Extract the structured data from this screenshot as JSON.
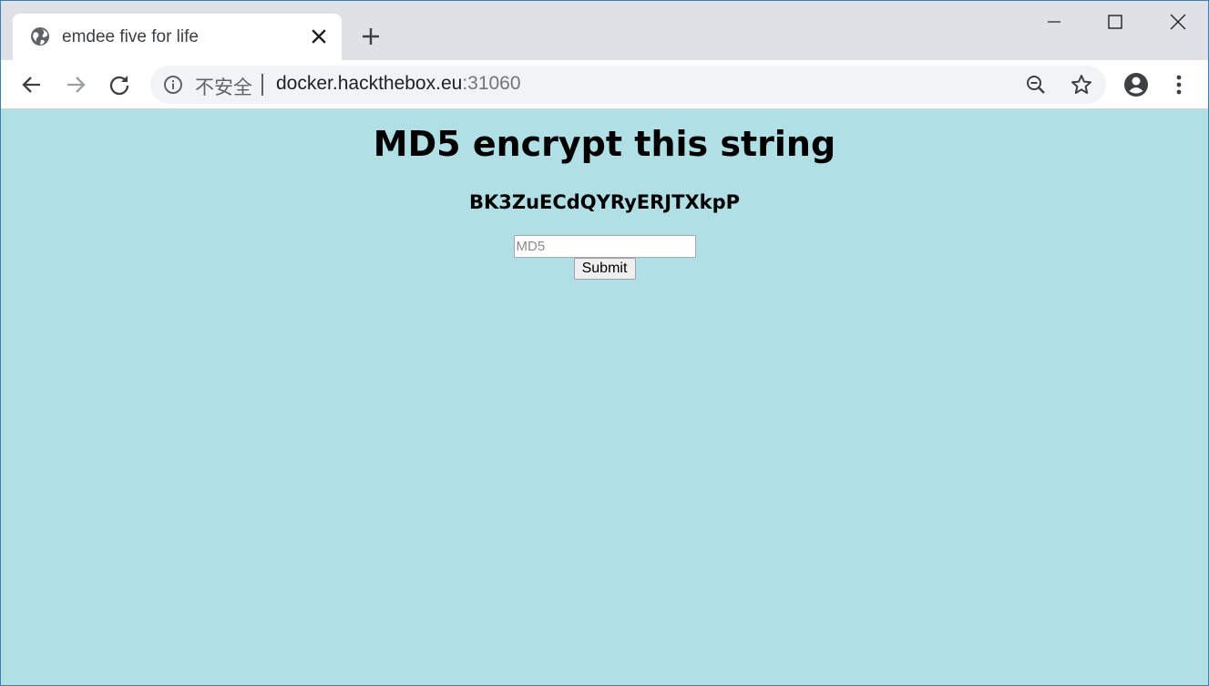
{
  "tab": {
    "title": "emdee five for life",
    "favicon": "globe-icon"
  },
  "omnibox": {
    "security_label": "不安全",
    "url_host": "docker.hackthebox.eu",
    "url_port": ":31060"
  },
  "page": {
    "heading": "MD5 encrypt this string",
    "challenge_string": "BK3ZuECdQYRyERJTXkpP",
    "input_placeholder": "MD5",
    "input_value": "",
    "submit_label": "Submit",
    "background_color": "#b0dfe5"
  }
}
